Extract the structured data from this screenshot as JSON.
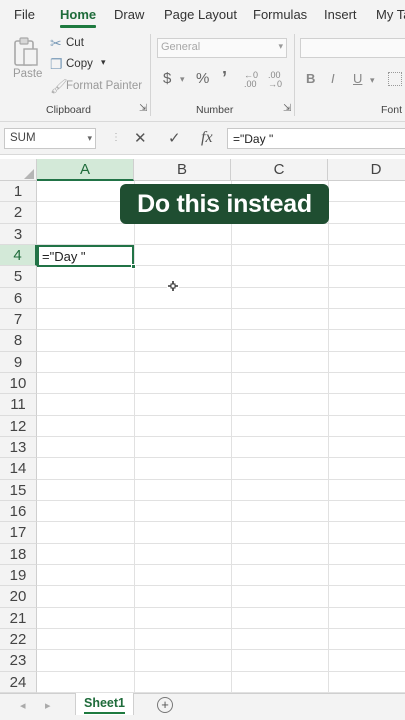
{
  "ribbon": {
    "tabs": [
      "File",
      "Home",
      "Draw",
      "Page Layout",
      "Formulas",
      "Insert",
      "My Ta"
    ],
    "active_tab": "Home",
    "clipboard": {
      "paste_label": "Paste",
      "cut_label": "Cut",
      "copy_label": "Copy",
      "format_painter_label": "Format Painter",
      "group_label": "Clipboard"
    },
    "number": {
      "format_value": "General",
      "currency_symbol": "$",
      "percent_symbol": "%",
      "comma_symbol": "’",
      "group_label": "Number"
    },
    "font": {
      "bold": "B",
      "italic": "I",
      "underline": "U",
      "group_label": "Font"
    }
  },
  "formula_bar": {
    "name_box": "SUM",
    "cancel_symbol": "✕",
    "enter_symbol": "✓",
    "fx_symbol": "fx",
    "formula": "=\"Day \""
  },
  "grid": {
    "columns": [
      "A",
      "B",
      "C",
      "D"
    ],
    "selected_column": "A",
    "rows": [
      "1",
      "2",
      "3",
      "4",
      "5",
      "6",
      "7",
      "8",
      "9",
      "10",
      "11",
      "12",
      "13",
      "14",
      "15",
      "16",
      "17",
      "18",
      "19",
      "20",
      "21",
      "22",
      "23",
      "24"
    ],
    "selected_row": "4",
    "active_cell_text": "=\"Day \""
  },
  "overlay": {
    "banner_text": "Do this instead",
    "banner_color": "#1f4e31"
  },
  "sheets": {
    "tabs": [
      "Sheet1"
    ],
    "add_symbol": "+"
  },
  "colors": {
    "accent": "#217346",
    "header_selected": "#d3e9d8"
  }
}
